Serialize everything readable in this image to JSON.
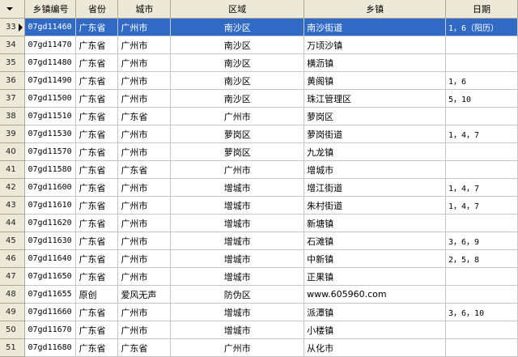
{
  "columns": [
    "乡镇编号",
    "省份",
    "城市",
    "区域",
    "乡镇",
    "日期"
  ],
  "selected_index": 0,
  "rows": [
    {
      "num": "33",
      "code": "07gd11460",
      "prov": "广东省",
      "city": "广州市",
      "district": "南沙区",
      "town": "南沙街道",
      "date": "1，6（阳历）"
    },
    {
      "num": "34",
      "code": "07gd11470",
      "prov": "广东省",
      "city": "广州市",
      "district": "南沙区",
      "town": "万顷沙镇",
      "date": ""
    },
    {
      "num": "35",
      "code": "07gd11480",
      "prov": "广东省",
      "city": "广州市",
      "district": "南沙区",
      "town": "横沥镇",
      "date": ""
    },
    {
      "num": "36",
      "code": "07gd11490",
      "prov": "广东省",
      "city": "广州市",
      "district": "南沙区",
      "town": "黄阁镇",
      "date": "1，6"
    },
    {
      "num": "37",
      "code": "07gd11500",
      "prov": "广东省",
      "city": "广州市",
      "district": "南沙区",
      "town": "珠江管理区",
      "date": "5，10"
    },
    {
      "num": "38",
      "code": "07gd11510",
      "prov": "广东省",
      "city": "广东省",
      "district": "广州市",
      "town": "萝岗区",
      "date": ""
    },
    {
      "num": "39",
      "code": "07gd11530",
      "prov": "广东省",
      "city": "广州市",
      "district": "萝岗区",
      "town": "萝岗街道",
      "date": "1，4，7"
    },
    {
      "num": "40",
      "code": "07gd11570",
      "prov": "广东省",
      "city": "广州市",
      "district": "萝岗区",
      "town": "九龙镇",
      "date": ""
    },
    {
      "num": "41",
      "code": "07gd11580",
      "prov": "广东省",
      "city": "广东省",
      "district": "广州市",
      "town": "增城市",
      "date": ""
    },
    {
      "num": "42",
      "code": "07gd11600",
      "prov": "广东省",
      "city": "广州市",
      "district": "增城市",
      "town": "增江街道",
      "date": "1，4，7"
    },
    {
      "num": "43",
      "code": "07gd11610",
      "prov": "广东省",
      "city": "广州市",
      "district": "增城市",
      "town": "朱村街道",
      "date": "1，4，7"
    },
    {
      "num": "44",
      "code": "07gd11620",
      "prov": "广东省",
      "city": "广州市",
      "district": "增城市",
      "town": "新塘镇",
      "date": ""
    },
    {
      "num": "45",
      "code": "07gd11630",
      "prov": "广东省",
      "city": "广州市",
      "district": "增城市",
      "town": "石滩镇",
      "date": "3，6，9"
    },
    {
      "num": "46",
      "code": "07gd11640",
      "prov": "广东省",
      "city": "广州市",
      "district": "增城市",
      "town": "中新镇",
      "date": "2，5，8"
    },
    {
      "num": "47",
      "code": "07gd11650",
      "prov": "广东省",
      "city": "广州市",
      "district": "增城市",
      "town": "正果镇",
      "date": ""
    },
    {
      "num": "48",
      "code": "07gd11655",
      "prov": "原创",
      "city": "爱风无声",
      "district": "防伪区",
      "town": "www.605960.com",
      "date": ""
    },
    {
      "num": "49",
      "code": "07gd11660",
      "prov": "广东省",
      "city": "广州市",
      "district": "增城市",
      "town": "派潭镇",
      "date": "3，6，10"
    },
    {
      "num": "50",
      "code": "07gd11670",
      "prov": "广东省",
      "city": "广州市",
      "district": "增城市",
      "town": "小楼镇",
      "date": ""
    },
    {
      "num": "51",
      "code": "07gd11680",
      "prov": "广东省",
      "city": "广东省",
      "district": "广州市",
      "town": "从化市",
      "date": ""
    }
  ]
}
